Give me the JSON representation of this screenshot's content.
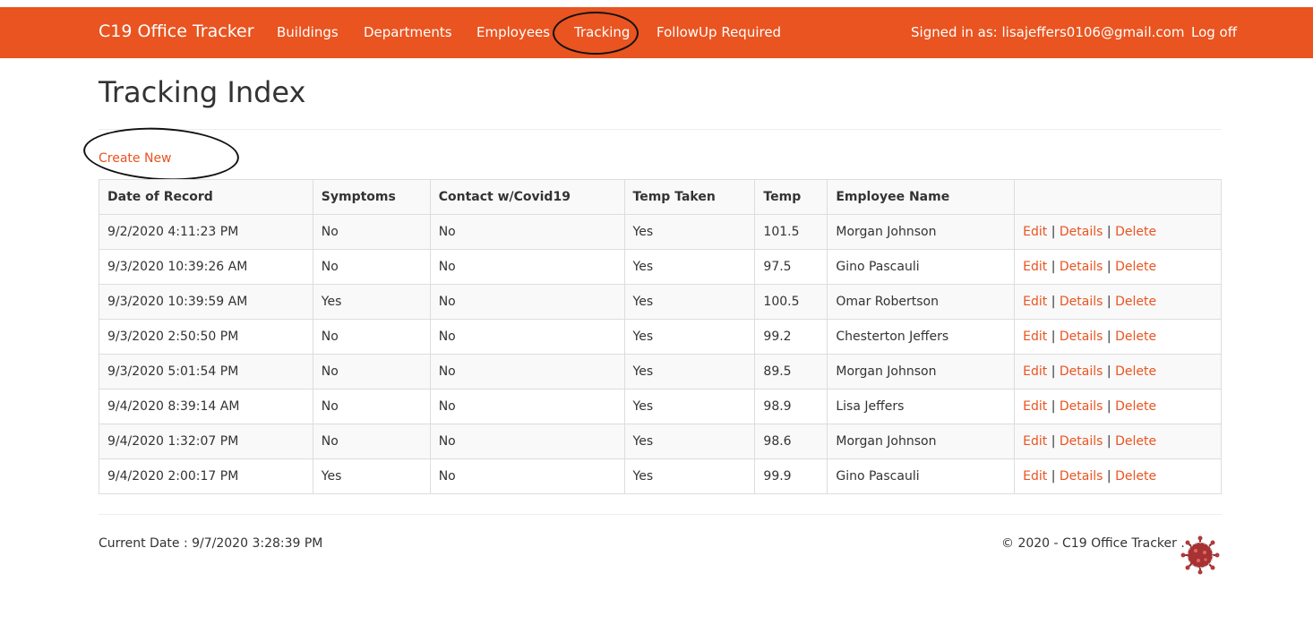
{
  "nav": {
    "brand": "C19 Office Tracker",
    "links": [
      "Buildings",
      "Departments",
      "Employees",
      "Tracking",
      "FollowUp Required"
    ],
    "signed_in": "Signed in as: lisajeffers0106@gmail.com",
    "logoff": "Log off"
  },
  "page": {
    "title": "Tracking Index",
    "create_new": "Create New"
  },
  "table": {
    "headers": [
      "Date of Record",
      "Symptoms",
      "Contact w/Covid19",
      "Temp Taken",
      "Temp",
      "Employee Name",
      ""
    ],
    "actions": {
      "edit": "Edit",
      "details": "Details",
      "delete": "Delete",
      "sep": "|"
    },
    "rows": [
      [
        "9/2/2020 4:11:23 PM",
        "No",
        "No",
        "Yes",
        "101.5",
        "Morgan Johnson"
      ],
      [
        "9/3/2020 10:39:26 AM",
        "No",
        "No",
        "Yes",
        "97.5",
        "Gino Pascauli"
      ],
      [
        "9/3/2020 10:39:59 AM",
        "Yes",
        "No",
        "Yes",
        "100.5",
        "Omar Robertson"
      ],
      [
        "9/3/2020 2:50:50 PM",
        "No",
        "No",
        "Yes",
        "99.2",
        "Chesterton Jeffers"
      ],
      [
        "9/3/2020 5:01:54 PM",
        "No",
        "No",
        "Yes",
        "89.5",
        "Morgan Johnson"
      ],
      [
        "9/4/2020 8:39:14 AM",
        "No",
        "No",
        "Yes",
        "98.9",
        "Lisa Jeffers"
      ],
      [
        "9/4/2020 1:32:07 PM",
        "No",
        "No",
        "Yes",
        "98.6",
        "Morgan Johnson"
      ],
      [
        "9/4/2020 2:00:17 PM",
        "Yes",
        "No",
        "Yes",
        "99.9",
        "Gino Pascauli"
      ]
    ]
  },
  "footer": {
    "current_date": "Current Date : 9/7/2020 3:28:39 PM",
    "copyright": "© 2020 - C19 Office Tracker ."
  },
  "colors": {
    "accent": "#e95420",
    "text": "#333333"
  },
  "icons": {
    "footer_logo": "virus-icon"
  }
}
